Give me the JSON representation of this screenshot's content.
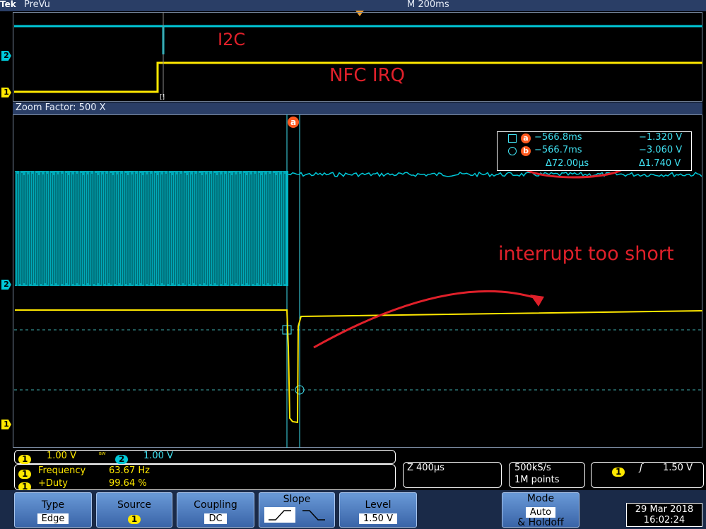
{
  "header": {
    "brand": "Tek",
    "mode": "PreVu",
    "timebase": "M 200ms"
  },
  "overview": {
    "label_i2c": "I2C",
    "label_irq": "NFC IRQ",
    "ch2_marker": "2",
    "ch1_marker": "1",
    "cursor_marker": "[]"
  },
  "zoom": {
    "factor_label": "Zoom Factor: 500 X",
    "cursor_a_marker": "a",
    "ch2_marker": "2",
    "ch1_marker": "1"
  },
  "cursors": {
    "row_a": {
      "icon": "a",
      "time": "−566.8ms",
      "volt": "−1.320 V"
    },
    "row_b": {
      "icon": "b",
      "time": "−566.7ms",
      "volt": "−3.060 V"
    },
    "delta_time": "Δ72.00µs",
    "delta_volt": "Δ1.740 V"
  },
  "annotation": {
    "text": "interrupt too short"
  },
  "channels": {
    "ch1_badge": "1",
    "ch1_scale": "1.00 V",
    "bw_symbol": "ᴮᵂ",
    "ch2_badge": "2",
    "ch2_scale": "1.00 V"
  },
  "measurements": [
    {
      "badge": "1",
      "name": "Frequency",
      "value": "63.67 Hz"
    },
    {
      "badge": "1",
      "name": "+Duty",
      "value": "99.64 %"
    }
  ],
  "zoom_time": "Z 400µs",
  "acquisition": {
    "rate": "500kS/s",
    "points": "1M points"
  },
  "trigger": {
    "badge": "1",
    "slope_symbol": "ʃ",
    "level": "1.50 V"
  },
  "menu": {
    "type": {
      "title": "Type",
      "value": "Edge"
    },
    "source": {
      "title": "Source",
      "value": "1"
    },
    "coupling": {
      "title": "Coupling",
      "value": "DC"
    },
    "slope": {
      "title": "Slope"
    },
    "level": {
      "title": "Level",
      "value": "1.50 V"
    },
    "mode": {
      "title": "Mode",
      "value": "Auto",
      "sub": "& Holdoff"
    }
  },
  "datetime": {
    "date": "29 Mar 2018",
    "time": "16:02:24"
  },
  "colors": {
    "ch1": "#ffe800",
    "ch2": "#00c8d8",
    "annotation": "#e0202a",
    "menu": "#4a7cc4"
  }
}
